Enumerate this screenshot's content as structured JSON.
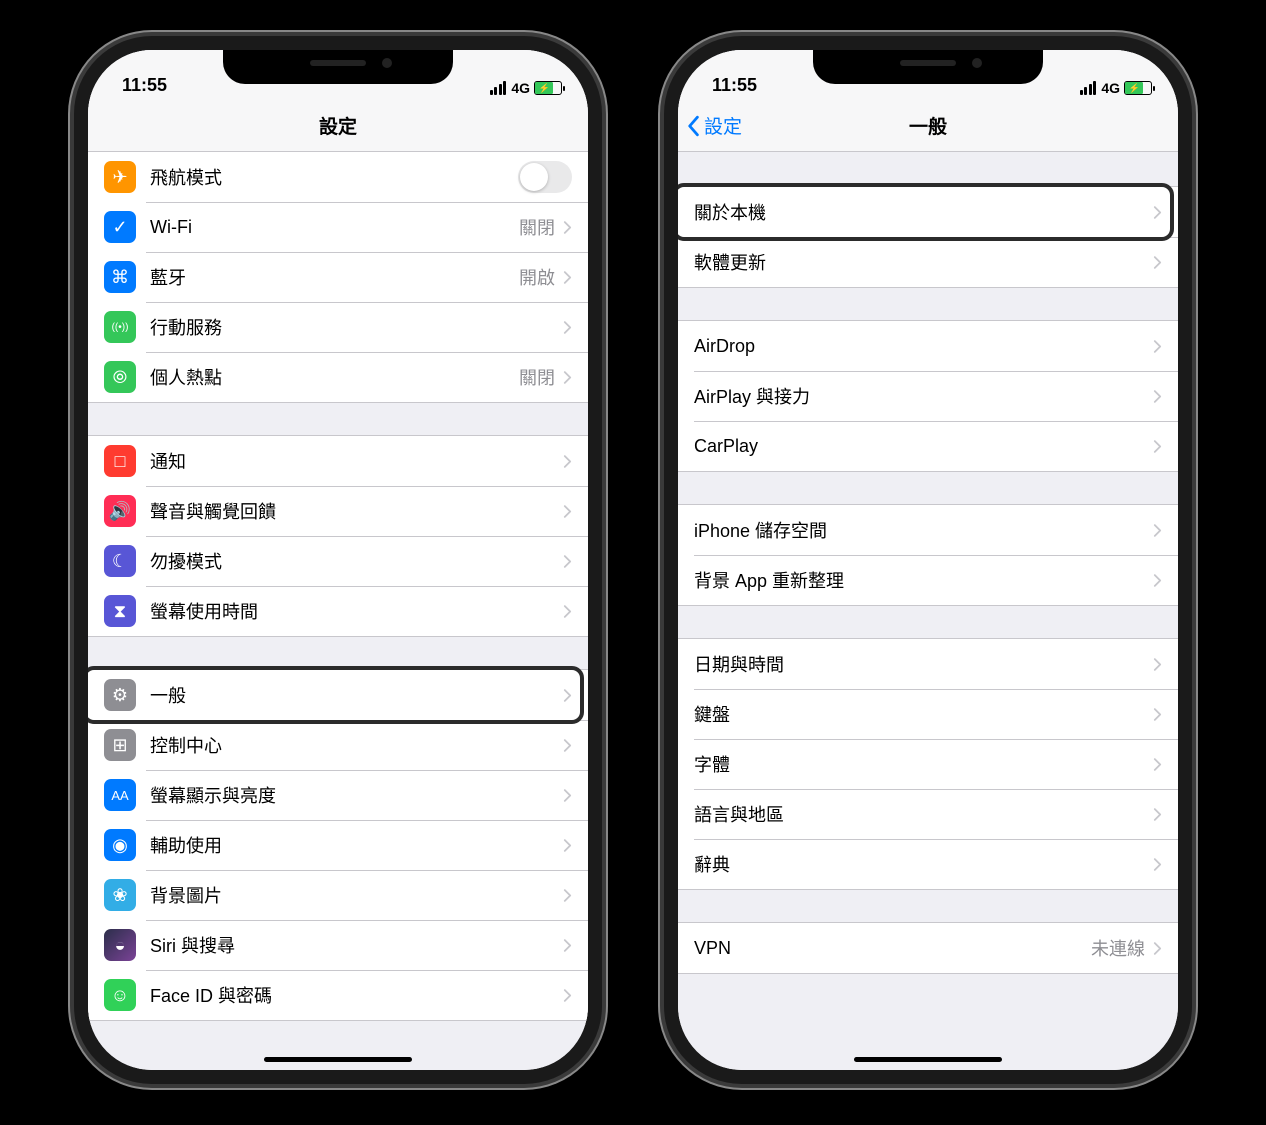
{
  "status": {
    "time": "11:55",
    "network": "4G"
  },
  "phone1": {
    "title": "設定",
    "groups": [
      [
        {
          "icon": "airplane-icon",
          "bg": "bg-orange",
          "label": "飛航模式",
          "type": "toggle"
        },
        {
          "icon": "wifi-icon",
          "bg": "bg-blue",
          "label": "Wi-Fi",
          "detail": "關閉",
          "type": "link"
        },
        {
          "icon": "bluetooth-icon",
          "bg": "bg-blue",
          "label": "藍牙",
          "detail": "開啟",
          "type": "link"
        },
        {
          "icon": "cellular-icon",
          "bg": "bg-green",
          "label": "行動服務",
          "type": "link"
        },
        {
          "icon": "hotspot-icon",
          "bg": "bg-green",
          "label": "個人熱點",
          "detail": "關閉",
          "type": "link"
        }
      ],
      [
        {
          "icon": "notifications-icon",
          "bg": "bg-red",
          "label": "通知",
          "type": "link"
        },
        {
          "icon": "sounds-icon",
          "bg": "bg-pink",
          "label": "聲音與觸覺回饋",
          "type": "link"
        },
        {
          "icon": "dnd-icon",
          "bg": "bg-purple",
          "label": "勿擾模式",
          "type": "link"
        },
        {
          "icon": "screentime-icon",
          "bg": "bg-indigo",
          "label": "螢幕使用時間",
          "type": "link"
        }
      ],
      [
        {
          "icon": "general-icon",
          "bg": "bg-gray",
          "label": "一般",
          "type": "link",
          "highlighted": true
        },
        {
          "icon": "control-center-icon",
          "bg": "bg-gray",
          "label": "控制中心",
          "type": "link"
        },
        {
          "icon": "display-icon",
          "bg": "bg-azure",
          "label": "螢幕顯示與亮度",
          "type": "link"
        },
        {
          "icon": "accessibility-icon",
          "bg": "bg-azure",
          "label": "輔助使用",
          "type": "link"
        },
        {
          "icon": "wallpaper-icon",
          "bg": "bg-teal",
          "label": "背景圖片",
          "type": "link"
        },
        {
          "icon": "siri-icon",
          "bg": "bg-grad",
          "label": "Siri 與搜尋",
          "type": "link"
        },
        {
          "icon": "faceid-icon",
          "bg": "bg-limegreen",
          "label": "Face ID 與密碼",
          "type": "link"
        }
      ]
    ]
  },
  "phone2": {
    "title": "一般",
    "back": "設定",
    "groups": [
      [
        {
          "label": "關於本機",
          "type": "link",
          "highlighted": true
        },
        {
          "label": "軟體更新",
          "type": "link"
        }
      ],
      [
        {
          "label": "AirDrop",
          "type": "link"
        },
        {
          "label": "AirPlay 與接力",
          "type": "link"
        },
        {
          "label": "CarPlay",
          "type": "link"
        }
      ],
      [
        {
          "label": "iPhone 儲存空間",
          "type": "link"
        },
        {
          "label": "背景 App 重新整理",
          "type": "link"
        }
      ],
      [
        {
          "label": "日期與時間",
          "type": "link"
        },
        {
          "label": "鍵盤",
          "type": "link"
        },
        {
          "label": "字體",
          "type": "link"
        },
        {
          "label": "語言與地區",
          "type": "link"
        },
        {
          "label": "辭典",
          "type": "link"
        }
      ],
      [
        {
          "label": "VPN",
          "detail": "未連線",
          "type": "link"
        }
      ]
    ]
  }
}
